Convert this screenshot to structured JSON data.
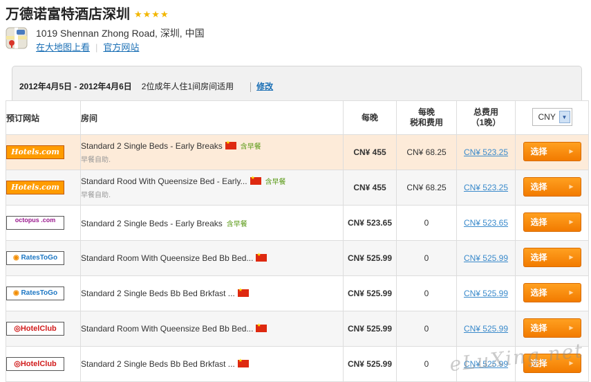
{
  "hotel": {
    "title": "万德诺富特酒店深圳",
    "stars": "★★★★",
    "address": "1019 Shennan Zhong Road, 深圳, 中国",
    "map_link": "在大地图上看",
    "site_link": "官方网站"
  },
  "search": {
    "dates": "2012年4月5日 - 2012年4月6日",
    "guests": "2位成年人住1间房间适用",
    "edit_label": "修改"
  },
  "table": {
    "headers": {
      "site": "预订网站",
      "room": "房间",
      "night": "每晚",
      "tax_line1": "每晚",
      "tax_line2": "税和费用",
      "total_line1": "总费用",
      "total_line2": "（1晚）"
    },
    "currency": "CNY",
    "select_label": "选择",
    "rows": [
      {
        "site": "Hotels.com",
        "logo": "hotels",
        "room": "Standard 2 Single Beds - Early Breaks",
        "flag": true,
        "breakfast": "含早餐",
        "sub": "早餐自助.",
        "night": "CN¥ 455",
        "tax": "CN¥ 68.25",
        "total": "CN¥ 523.25",
        "style": "hl"
      },
      {
        "site": "Hotels.com",
        "logo": "hotels",
        "room": "Standard Rood With Queensize Bed - Early...",
        "flag": true,
        "breakfast": "含早餐",
        "sub": "早餐自助.",
        "night": "CN¥ 455",
        "tax": "CN¥ 68.25",
        "total": "CN¥ 523.25",
        "style": "alt"
      },
      {
        "site": "octopus .com",
        "logo": "octopus",
        "room": "Standard 2 Single Beds - Early Breaks",
        "flag": false,
        "breakfast": "含早餐",
        "sub": "",
        "night": "CN¥ 523.65",
        "tax": "0",
        "total": "CN¥ 523.65",
        "style": ""
      },
      {
        "site": "RatesToGo",
        "logo": "rates",
        "room": "Standard Room With Queensize Bed Bb Bed...",
        "flag": true,
        "breakfast": "",
        "sub": "",
        "night": "CN¥ 525.99",
        "tax": "0",
        "total": "CN¥ 525.99",
        "style": "alt"
      },
      {
        "site": "RatesToGo",
        "logo": "rates",
        "room": "Standard 2 Single Beds Bb Bed Brkfast ...",
        "flag": true,
        "breakfast": "",
        "sub": "",
        "night": "CN¥ 525.99",
        "tax": "0",
        "total": "CN¥ 525.99",
        "style": ""
      },
      {
        "site": "HotelClub",
        "logo": "hc",
        "room": "Standard Room With Queensize Bed Bb Bed...",
        "flag": true,
        "breakfast": "",
        "sub": "",
        "night": "CN¥ 525.99",
        "tax": "0",
        "total": "CN¥ 525.99",
        "style": "alt"
      },
      {
        "site": "HotelClub",
        "logo": "hc",
        "room": "Standard 2 Single Beds Bb Bed Brkfast ...",
        "flag": true,
        "breakfast": "",
        "sub": "",
        "night": "CN¥ 525.99",
        "tax": "0",
        "total": "CN¥ 525.99",
        "style": ""
      }
    ]
  },
  "watermark": "eLuXing.net",
  "icons": {
    "map": "map-icon",
    "flag": "china-flag-icon",
    "arrow": "chevron-right-icon"
  },
  "colors": {
    "accent": "#f27b00",
    "link": "#1a6fb5",
    "highlight_row": "#fdebd9",
    "stars": "#f2b600"
  }
}
